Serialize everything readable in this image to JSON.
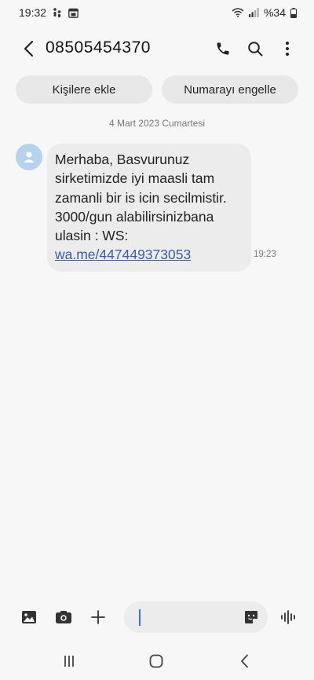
{
  "status_bar": {
    "time": "19:32",
    "battery": "%34"
  },
  "header": {
    "phone_number": "08505454370"
  },
  "actions": {
    "add_contact": "Kişilere ekle",
    "block_number": "Numarayı engelle"
  },
  "conversation": {
    "date_separator": "4 Mart 2023 Cumartesi",
    "messages": [
      {
        "text": "Merhaba, Basvurunuz sirketimizde iyi maasli tam zamanli bir is icin secilmistir. 3000/gun alabilirsinizbana ulasin : WS: ",
        "link": "wa.me/447449373053",
        "time": "19:23"
      }
    ]
  },
  "composer": {
    "input_value": ""
  },
  "colors": {
    "link": "#3a5ca8",
    "avatar": "#b5d3ef",
    "caret": "#3a6fd8"
  }
}
